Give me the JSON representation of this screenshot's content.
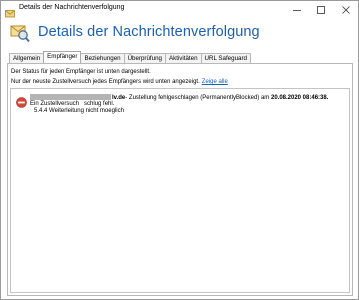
{
  "window": {
    "title": "Details der Nachrichtenverfolgung",
    "minimize_glyph": "—",
    "maximize_glyph": "☐",
    "close_glyph": "✕"
  },
  "header": {
    "title": "Details der Nachrichtenverfolgung",
    "icon": "magnifier-envelope-icon",
    "title_color": "#1d5fae"
  },
  "tabs": [
    {
      "label": "Allgemein",
      "active": false
    },
    {
      "label": "Empfänger",
      "active": true
    },
    {
      "label": "Beziehungen",
      "active": false
    },
    {
      "label": "Überprüfung",
      "active": false
    },
    {
      "label": "Aktivitäten",
      "active": false
    },
    {
      "label": "URL Safeguard",
      "active": false
    }
  ],
  "content": {
    "status_text": "Der Status für jeden Empfänger ist unten dargestellt.",
    "recent_text": "Nur der neuste Zustellversuch jedes Empfängers wird unten angezeigt.",
    "show_all_link": "Zeige alle"
  },
  "entry": {
    "icon": "error-blocked-icon",
    "recipient_suffix": "lv.de",
    "message": "- Zustellung fehlgeschlagen (PermanentlyBlocked) am ",
    "timestamp": "20.08.2020 08:46:38.",
    "line2_part1": "Ein Zustellversuch",
    "line2_part2": "schlug fehl.",
    "line3": "5.4.4 Weiterleitung nicht moeglich"
  }
}
